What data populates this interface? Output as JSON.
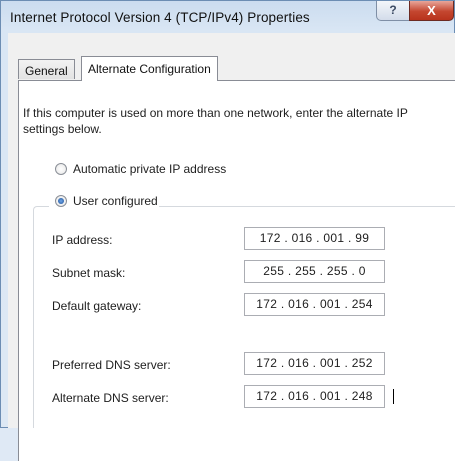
{
  "window": {
    "title": "Internet Protocol Version 4 (TCP/IPv4) Properties",
    "help_label": "?",
    "close_label": "X"
  },
  "tabs": [
    {
      "label": "General",
      "selected": false
    },
    {
      "label": "Alternate Configuration",
      "selected": true
    }
  ],
  "intro_text": "If this computer is used on more than one network, enter the alternate IP settings below.",
  "options": {
    "automatic_label": "Automatic private IP address",
    "automatic_selected": false,
    "user_label": "User configured",
    "user_selected": true
  },
  "fields": [
    {
      "label": "IP address:",
      "value": "172 . 016 . 001 . 99"
    },
    {
      "label": "Subnet mask:",
      "value": "255 . 255 . 255 .  0"
    },
    {
      "label": "Default gateway:",
      "value": "172 . 016 . 001 . 254"
    },
    {
      "label": "Preferred DNS server:",
      "value": "172 . 016 . 001 . 252"
    },
    {
      "label": "Alternate DNS server:",
      "value": "172 . 016 . 001 . 248"
    }
  ]
}
